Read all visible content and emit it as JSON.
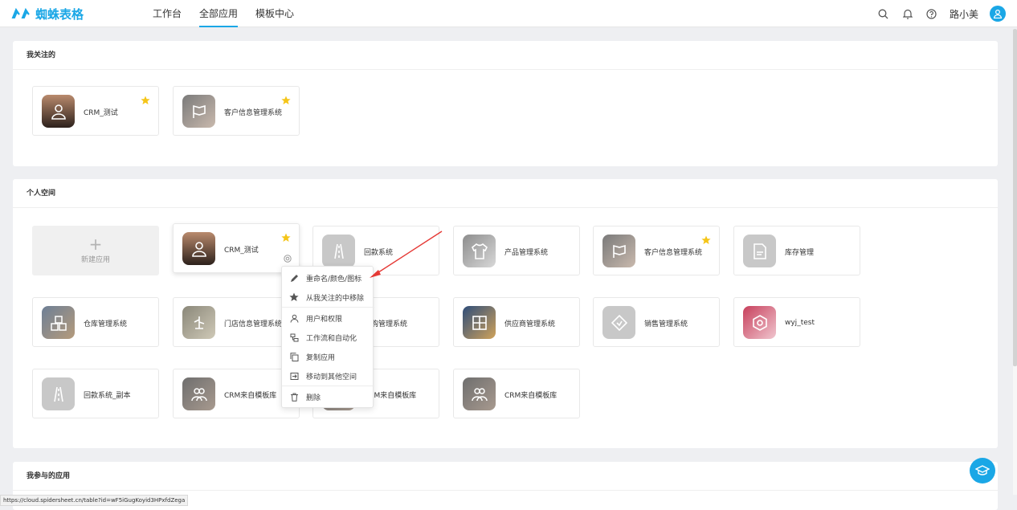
{
  "app": {
    "logo_text": "蜘蛛表格",
    "brand_color": "#1aa7e6"
  },
  "nav": {
    "items": [
      {
        "label": "工作台",
        "active": false
      },
      {
        "label": "全部应用",
        "active": true
      },
      {
        "label": "模板中心",
        "active": false
      }
    ]
  },
  "header": {
    "user_name": "路小美",
    "icons": [
      "search-icon",
      "bell-icon",
      "help-icon",
      "user-avatar-icon"
    ]
  },
  "favorites": {
    "title": "我关注的",
    "apps": [
      {
        "name": "CRM_测试",
        "starred": true,
        "icon": "person-icon"
      },
      {
        "name": "客户信息管理系统",
        "starred": true,
        "icon": "flag-icon"
      }
    ]
  },
  "personal": {
    "title": "个人空间",
    "new_app_label": "新建应用",
    "new_app_icon": "plus-icon",
    "apps": [
      {
        "name": "CRM_测试",
        "starred": true,
        "icon": "person-icon"
      },
      {
        "name": "回款系统",
        "starred": false,
        "icon": "road-icon"
      },
      {
        "name": "产品管理系统",
        "starred": false,
        "icon": "shirt-icon"
      },
      {
        "name": "客户信息管理系统",
        "starred": true,
        "icon": "flag-icon"
      },
      {
        "name": "库存管理",
        "starred": false,
        "icon": "document-icon"
      },
      {
        "name": "仓库管理系统",
        "starred": false,
        "icon": "boxes-icon"
      },
      {
        "name": "门店信息管理系统",
        "starred": false,
        "icon": "store-icon"
      },
      {
        "name": "采购管理系统",
        "starred": false,
        "icon": "cart-icon"
      },
      {
        "name": "供应商管理系统",
        "starred": false,
        "icon": "window-icon"
      },
      {
        "name": "销售管理系统",
        "starred": false,
        "icon": "tag-icon"
      },
      {
        "name": "wyj_test",
        "starred": false,
        "icon": "hexagon-icon"
      },
      {
        "name": "回款系统_副本",
        "starred": false,
        "icon": "road-icon"
      },
      {
        "name": "CRM来自模板库",
        "starred": false,
        "icon": "group-icon"
      },
      {
        "name": "CRM来自模板库",
        "starred": false,
        "icon": "group-icon"
      },
      {
        "name": "CRM来自模板库",
        "starred": false,
        "icon": "group-icon"
      }
    ]
  },
  "participating": {
    "title": "我参与的应用"
  },
  "context_menu": {
    "items": [
      {
        "label": "重命名/颜色/图标",
        "icon": "pencil-icon"
      },
      {
        "label": "从我关注的中移除",
        "icon": "star-icon"
      },
      {
        "label": "用户和权限",
        "icon": "users-icon"
      },
      {
        "label": "工作流和自动化",
        "icon": "workflow-icon"
      },
      {
        "label": "复制应用",
        "icon": "copy-icon"
      },
      {
        "label": "移动到其他空间",
        "icon": "move-icon"
      },
      {
        "label": "删除",
        "icon": "trash-icon"
      }
    ]
  },
  "status_bar": {
    "url": "https://cloud.spidersheet.cn/table?id=wF5iGugKoyid3HPxfdZega"
  },
  "colors": {
    "star": "#f5c518",
    "accent": "#1aa7e6",
    "annotation_arrow": "#e53935"
  }
}
